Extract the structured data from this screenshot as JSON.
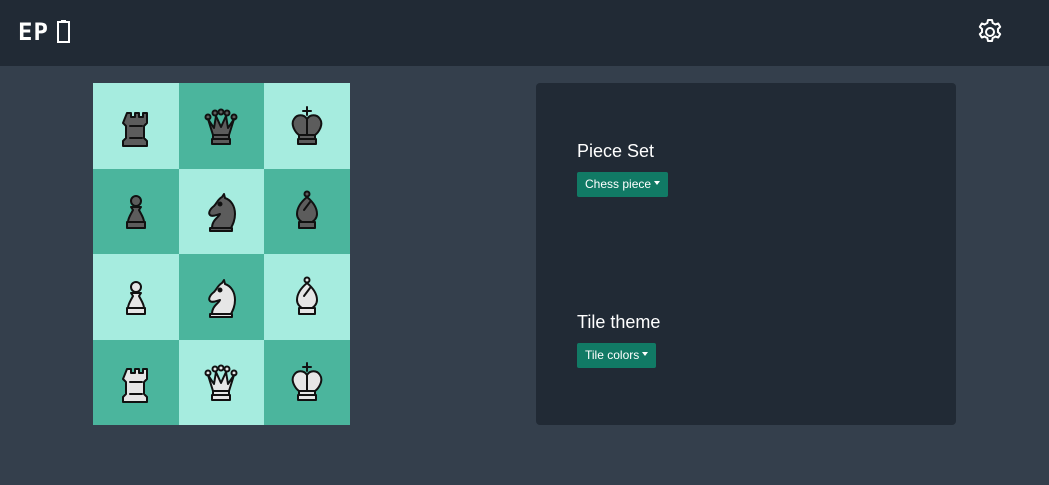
{
  "header": {
    "logo_text": "EP",
    "logo_icon": "book-outline-icon",
    "settings_icon": "gear-icon"
  },
  "theme": {
    "background": "#343f4c",
    "header_bg": "#212a35",
    "panel_bg": "#212a35",
    "tile_light": "#a6ecdf",
    "tile_dark": "#4bb59d",
    "button_bg": "#117a65"
  },
  "board": {
    "tiles": [
      {
        "piece": "rook",
        "color": "black",
        "shade": "light"
      },
      {
        "piece": "queen",
        "color": "black",
        "shade": "dark"
      },
      {
        "piece": "king",
        "color": "black",
        "shade": "light"
      },
      {
        "piece": "pawn",
        "color": "black",
        "shade": "dark"
      },
      {
        "piece": "knight",
        "color": "black",
        "shade": "light"
      },
      {
        "piece": "bishop",
        "color": "black",
        "shade": "dark"
      },
      {
        "piece": "pawn",
        "color": "white",
        "shade": "light"
      },
      {
        "piece": "knight",
        "color": "white",
        "shade": "dark"
      },
      {
        "piece": "bishop",
        "color": "white",
        "shade": "light"
      },
      {
        "piece": "rook",
        "color": "white",
        "shade": "dark"
      },
      {
        "piece": "queen",
        "color": "white",
        "shade": "light"
      },
      {
        "piece": "king",
        "color": "white",
        "shade": "dark"
      }
    ]
  },
  "settings": {
    "piece_set": {
      "title": "Piece Set",
      "button_label": "Chess piece"
    },
    "tile_theme": {
      "title": "Tile theme",
      "button_label": "Tile colors"
    }
  }
}
